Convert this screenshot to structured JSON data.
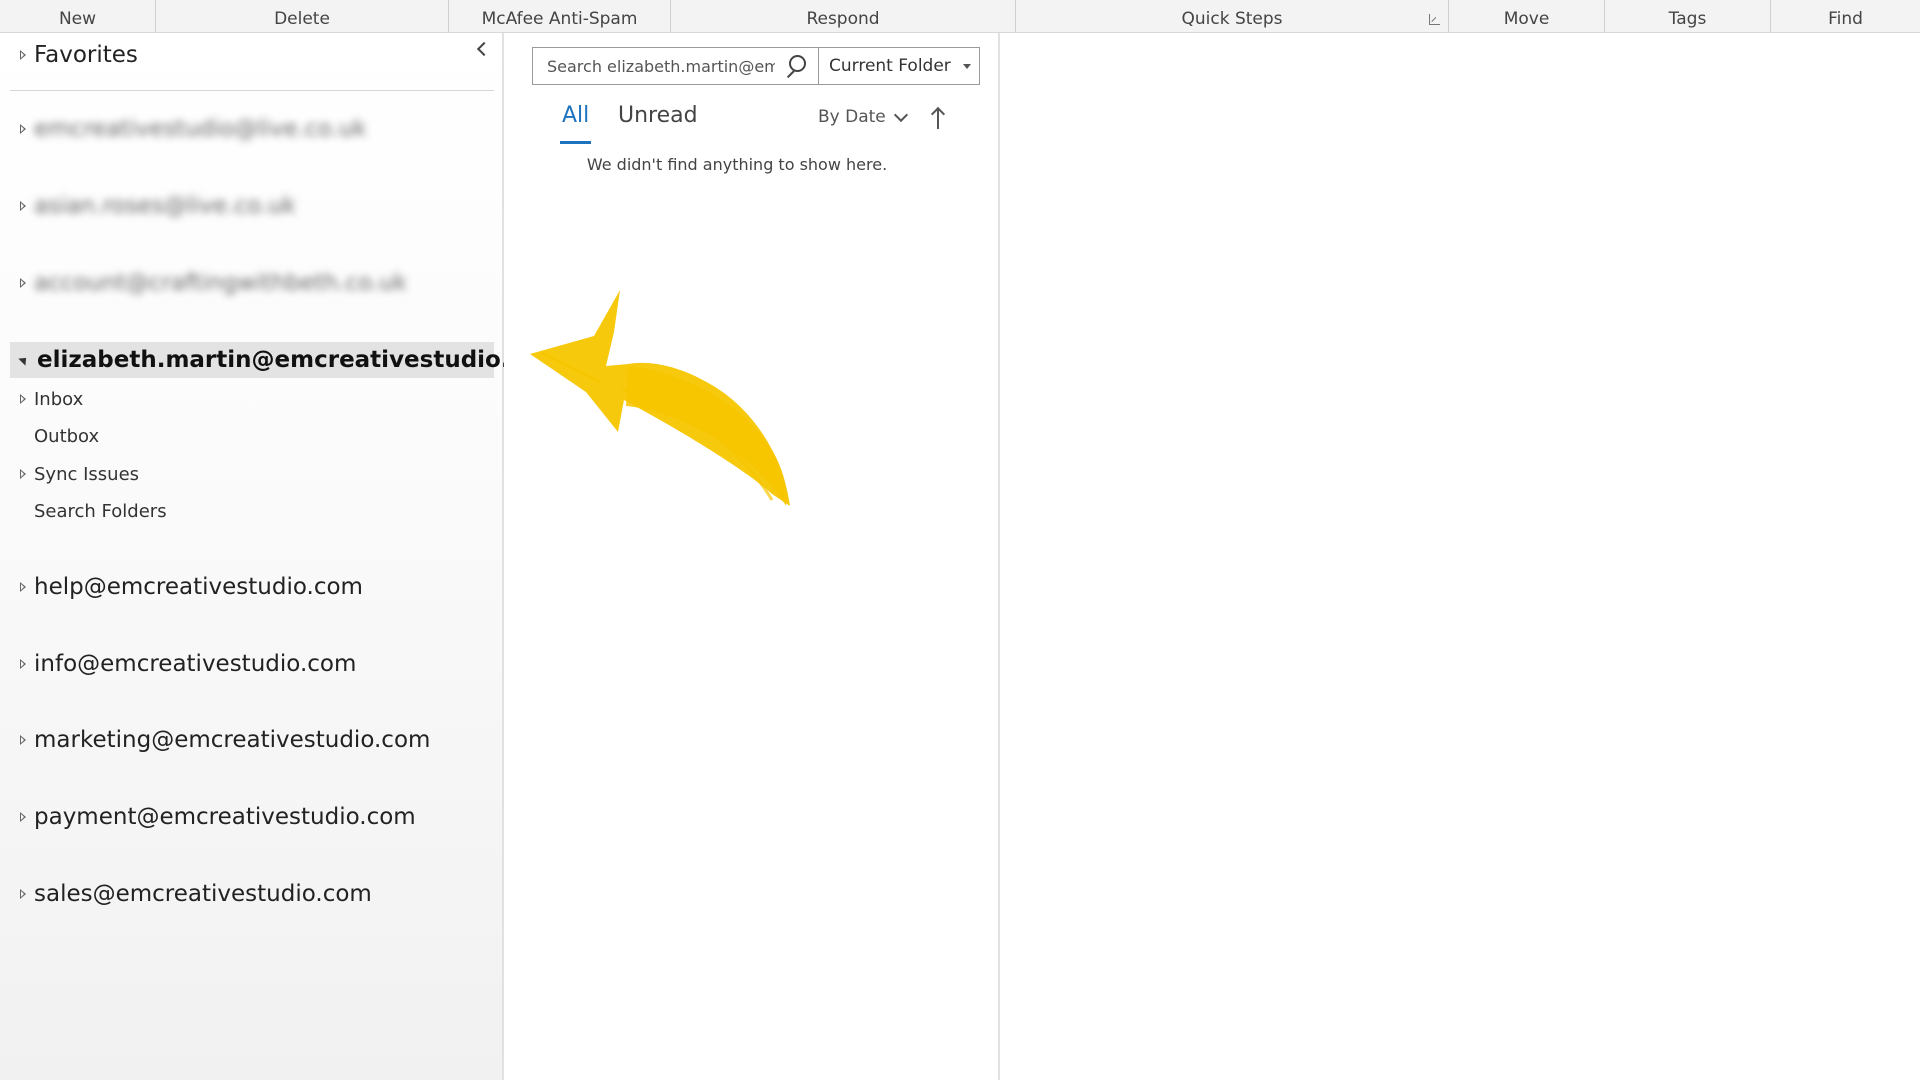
{
  "ribbon": {
    "groups": [
      {
        "label": "New"
      },
      {
        "label": "Delete"
      },
      {
        "label": "McAfee Anti-Spam"
      },
      {
        "label": "Respond"
      },
      {
        "label": "Quick Steps"
      },
      {
        "label": "Move"
      },
      {
        "label": "Tags"
      },
      {
        "label": "Find"
      }
    ]
  },
  "folders": {
    "favorites": "Favorites",
    "accounts_blurred": [
      "emcreativestudio@live.co.uk",
      "asian.roses@live.co.uk",
      "account@craftingwithbeth.co.uk"
    ],
    "selected_account": "elizabeth.martin@emcreativestudio.com",
    "subfolders": [
      {
        "label": "Inbox"
      },
      {
        "label": "Outbox"
      },
      {
        "label": "Sync Issues"
      },
      {
        "label": "Search Folders"
      }
    ],
    "other_accounts": [
      "help@emcreativestudio.com",
      "info@emcreativestudio.com",
      "marketing@emcreativestudio.com",
      "payment@emcreativestudio.com",
      "sales@emcreativestudio.com"
    ]
  },
  "list": {
    "search_placeholder": "Search elizabeth.martin@emcreativestudio.com",
    "scope": "Current Folder",
    "tab_all": "All",
    "tab_unread": "Unread",
    "sort_label": "By Date",
    "empty_message": "We didn't find anything to show here."
  },
  "colors": {
    "accent": "#1e73be",
    "arrow": "#f7c600",
    "selected_bg": "#e3e3e3"
  }
}
